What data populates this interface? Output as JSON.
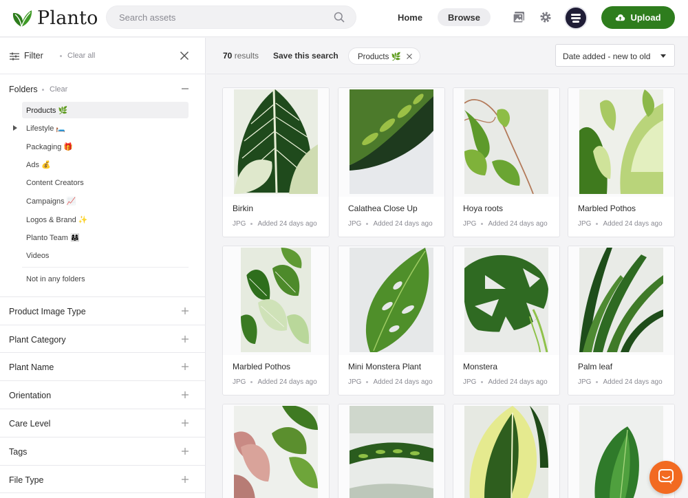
{
  "app": {
    "name": "Planto"
  },
  "header": {
    "search_placeholder": "Search assets",
    "nav_home": "Home",
    "nav_browse": "Browse",
    "upload_label": "Upload",
    "brand_color": "#2e7d1d"
  },
  "sidebar": {
    "filter_label": "Filter",
    "clear_all": "Clear all",
    "folders_title": "Folders",
    "folders_clear": "Clear",
    "folders": [
      {
        "label": "Products 🌿"
      },
      {
        "label": "Lifestyle 🛏️"
      },
      {
        "label": "Packaging 🎁"
      },
      {
        "label": "Ads 💰"
      },
      {
        "label": "Content Creators"
      },
      {
        "label": "Campaigns 📈"
      },
      {
        "label": "Logos & Brand ✨"
      },
      {
        "label": "Planto Team 👩‍👩‍👧"
      },
      {
        "label": "Videos"
      }
    ],
    "not_in_folders": "Not in any folders",
    "facets": [
      {
        "label": "Product Image Type"
      },
      {
        "label": "Plant Category"
      },
      {
        "label": "Plant Name"
      },
      {
        "label": "Orientation"
      },
      {
        "label": "Care Level"
      },
      {
        "label": "Tags"
      },
      {
        "label": "File Type"
      }
    ]
  },
  "toolbar": {
    "results_count": "70",
    "results_label": "results",
    "save_search": "Save this search",
    "chip": "Products 🌿",
    "sort": "Date added - new to old"
  },
  "assets": [
    {
      "title": "Birkin",
      "type": "JPG",
      "added": "Added 24 days ago"
    },
    {
      "title": "Calathea Close Up",
      "type": "JPG",
      "added": "Added 24 days ago"
    },
    {
      "title": "Hoya roots",
      "type": "JPG",
      "added": "Added 24 days ago"
    },
    {
      "title": "Marbled Pothos",
      "type": "JPG",
      "added": "Added 24 days ago"
    },
    {
      "title": "Marbled Pothos",
      "type": "JPG",
      "added": "Added 24 days ago"
    },
    {
      "title": "Mini Monstera Plant",
      "type": "JPG",
      "added": "Added 24 days ago"
    },
    {
      "title": "Monstera",
      "type": "JPG",
      "added": "Added 24 days ago"
    },
    {
      "title": "Palm leaf",
      "type": "JPG",
      "added": "Added 24 days ago"
    }
  ]
}
